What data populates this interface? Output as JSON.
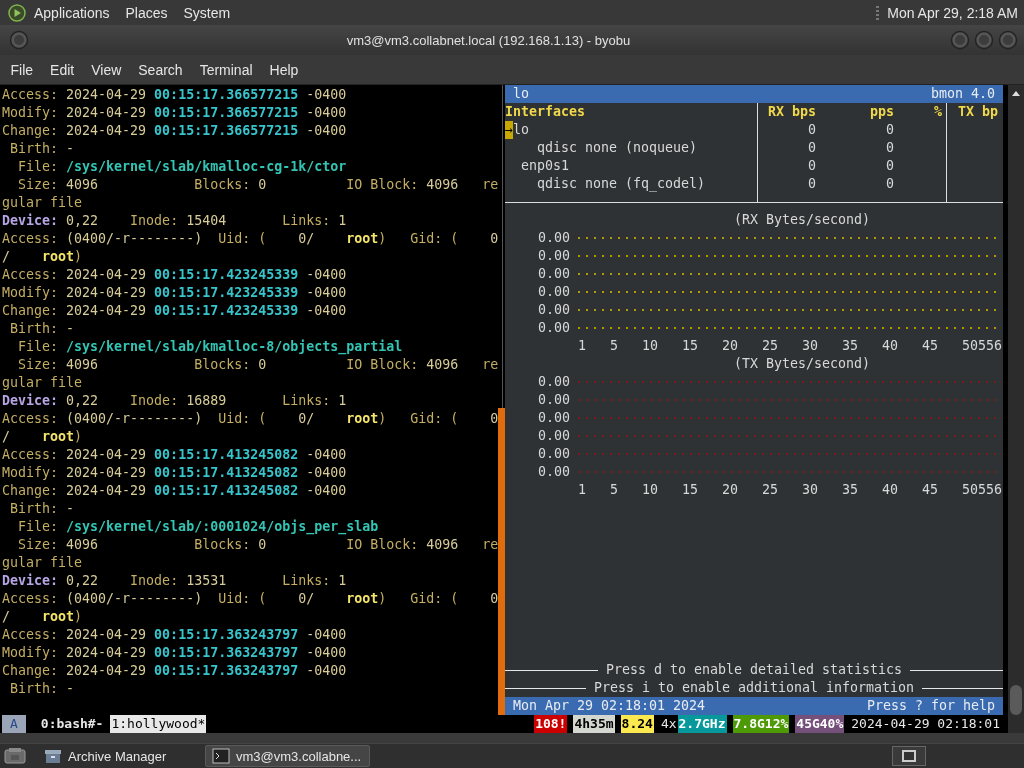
{
  "top_panel": {
    "menus": [
      "Applications",
      "Places",
      "System"
    ],
    "clock": "Mon Apr 29, 2:18 AM"
  },
  "window": {
    "title": "vm3@vm3.collabnet.local (192.168.1.13) - byobu"
  },
  "menu_bar": [
    "File",
    "Edit",
    "View",
    "Search",
    "Terminal",
    "Help"
  ],
  "terminal_lines": [
    {
      "segments": [
        {
          "kind": "label",
          "text": "Access: "
        },
        {
          "kind": "number",
          "text": "2024-04-29 "
        },
        {
          "kind": "time",
          "text": "00:15:17.366577215"
        },
        {
          "kind": "number",
          "text": " -0400"
        }
      ]
    },
    {
      "segments": [
        {
          "kind": "label",
          "text": "Modify: "
        },
        {
          "kind": "number",
          "text": "2024-04-29 "
        },
        {
          "kind": "time",
          "text": "00:15:17.366577215"
        },
        {
          "kind": "number",
          "text": " -0400"
        }
      ]
    },
    {
      "segments": [
        {
          "kind": "label",
          "text": "Change: "
        },
        {
          "kind": "number",
          "text": "2024-04-29 "
        },
        {
          "kind": "time",
          "text": "00:15:17.366577215"
        },
        {
          "kind": "number",
          "text": " -0400"
        }
      ]
    },
    {
      "segments": [
        {
          "kind": "label",
          "text": " Birth: "
        },
        {
          "kind": "number",
          "text": "-"
        }
      ]
    },
    {
      "segments": [
        {
          "kind": "label",
          "text": "  File: "
        },
        {
          "kind": "path",
          "text": "/sys/kernel/slab/kmalloc-cg-1k/ctor"
        }
      ]
    },
    {
      "segments": [
        {
          "kind": "label",
          "text": "  Size: "
        },
        {
          "kind": "number",
          "text": "4096"
        },
        {
          "kind": "label",
          "text": "            Blocks: "
        },
        {
          "kind": "number",
          "text": "0"
        },
        {
          "kind": "label",
          "text": "          IO Block: "
        },
        {
          "kind": "number",
          "text": "4096"
        },
        {
          "kind": "label",
          "text": "   re"
        }
      ]
    },
    {
      "segments": [
        {
          "kind": "label",
          "text": "gular file"
        }
      ]
    },
    {
      "segments": [
        {
          "kind": "device",
          "text": "Device: "
        },
        {
          "kind": "number",
          "text": "0,22"
        },
        {
          "kind": "label",
          "text": "    Inode: "
        },
        {
          "kind": "number",
          "text": "15404"
        },
        {
          "kind": "label",
          "text": "       Links: "
        },
        {
          "kind": "number",
          "text": "1"
        }
      ]
    },
    {
      "segments": [
        {
          "kind": "label",
          "text": "Access: "
        },
        {
          "kind": "number",
          "text": "(0400/-r--------)"
        },
        {
          "kind": "label",
          "text": "  Uid: ("
        },
        {
          "kind": "number",
          "text": "    0/    "
        },
        {
          "kind": "user",
          "text": "root"
        },
        {
          "kind": "label",
          "text": ")   Gid: ("
        },
        {
          "kind": "number",
          "text": "    0"
        }
      ]
    },
    {
      "segments": [
        {
          "kind": "number",
          "text": "/    "
        },
        {
          "kind": "user",
          "text": "root"
        },
        {
          "kind": "label",
          "text": ")"
        }
      ]
    },
    {
      "segments": [
        {
          "kind": "label",
          "text": "Access: "
        },
        {
          "kind": "number",
          "text": "2024-04-29 "
        },
        {
          "kind": "time",
          "text": "00:15:17.423245339"
        },
        {
          "kind": "number",
          "text": " -0400"
        }
      ]
    },
    {
      "segments": [
        {
          "kind": "label",
          "text": "Modify: "
        },
        {
          "kind": "number",
          "text": "2024-04-29 "
        },
        {
          "kind": "time",
          "text": "00:15:17.423245339"
        },
        {
          "kind": "number",
          "text": " -0400"
        }
      ]
    },
    {
      "segments": [
        {
          "kind": "label",
          "text": "Change: "
        },
        {
          "kind": "number",
          "text": "2024-04-29 "
        },
        {
          "kind": "time",
          "text": "00:15:17.423245339"
        },
        {
          "kind": "number",
          "text": " -0400"
        }
      ]
    },
    {
      "segments": [
        {
          "kind": "label",
          "text": " Birth: "
        },
        {
          "kind": "number",
          "text": "-"
        }
      ]
    },
    {
      "segments": [
        {
          "kind": "label",
          "text": "  File: "
        },
        {
          "kind": "path",
          "text": "/sys/kernel/slab/kmalloc-8/objects_partial"
        }
      ]
    },
    {
      "segments": [
        {
          "kind": "label",
          "text": "  Size: "
        },
        {
          "kind": "number",
          "text": "4096"
        },
        {
          "kind": "label",
          "text": "            Blocks: "
        },
        {
          "kind": "number",
          "text": "0"
        },
        {
          "kind": "label",
          "text": "          IO Block: "
        },
        {
          "kind": "number",
          "text": "4096"
        },
        {
          "kind": "label",
          "text": "   re"
        }
      ]
    },
    {
      "segments": [
        {
          "kind": "label",
          "text": "gular file"
        }
      ]
    },
    {
      "segments": [
        {
          "kind": "device",
          "text": "Device: "
        },
        {
          "kind": "number",
          "text": "0,22"
        },
        {
          "kind": "label",
          "text": "    Inode: "
        },
        {
          "kind": "number",
          "text": "16889"
        },
        {
          "kind": "label",
          "text": "       Links: "
        },
        {
          "kind": "number",
          "text": "1"
        }
      ]
    },
    {
      "segments": [
        {
          "kind": "label",
          "text": "Access: "
        },
        {
          "kind": "number",
          "text": "(0400/-r--------)"
        },
        {
          "kind": "label",
          "text": "  Uid: ("
        },
        {
          "kind": "number",
          "text": "    0/    "
        },
        {
          "kind": "user",
          "text": "root"
        },
        {
          "kind": "label",
          "text": ")   Gid: ("
        },
        {
          "kind": "number",
          "text": "    0"
        }
      ]
    },
    {
      "segments": [
        {
          "kind": "number",
          "text": "/    "
        },
        {
          "kind": "user",
          "text": "root"
        },
        {
          "kind": "label",
          "text": ")"
        }
      ]
    },
    {
      "segments": [
        {
          "kind": "label",
          "text": "Access: "
        },
        {
          "kind": "number",
          "text": "2024-04-29 "
        },
        {
          "kind": "time",
          "text": "00:15:17.413245082"
        },
        {
          "kind": "number",
          "text": " -0400"
        }
      ]
    },
    {
      "segments": [
        {
          "kind": "label",
          "text": "Modify: "
        },
        {
          "kind": "number",
          "text": "2024-04-29 "
        },
        {
          "kind": "time",
          "text": "00:15:17.413245082"
        },
        {
          "kind": "number",
          "text": " -0400"
        }
      ]
    },
    {
      "segments": [
        {
          "kind": "label",
          "text": "Change: "
        },
        {
          "kind": "number",
          "text": "2024-04-29 "
        },
        {
          "kind": "time",
          "text": "00:15:17.413245082"
        },
        {
          "kind": "number",
          "text": " -0400"
        }
      ]
    },
    {
      "segments": [
        {
          "kind": "label",
          "text": " Birth: "
        },
        {
          "kind": "number",
          "text": "-"
        }
      ]
    },
    {
      "segments": [
        {
          "kind": "label",
          "text": "  File: "
        },
        {
          "kind": "path",
          "text": "/sys/kernel/slab/:0001024/objs_per_slab"
        }
      ]
    },
    {
      "segments": [
        {
          "kind": "label",
          "text": "  Size: "
        },
        {
          "kind": "number",
          "text": "4096"
        },
        {
          "kind": "label",
          "text": "            Blocks: "
        },
        {
          "kind": "number",
          "text": "0"
        },
        {
          "kind": "label",
          "text": "          IO Block: "
        },
        {
          "kind": "number",
          "text": "4096"
        },
        {
          "kind": "label",
          "text": "   re"
        }
      ]
    },
    {
      "segments": [
        {
          "kind": "label",
          "text": "gular file"
        }
      ]
    },
    {
      "segments": [
        {
          "kind": "device",
          "text": "Device: "
        },
        {
          "kind": "number",
          "text": "0,22"
        },
        {
          "kind": "label",
          "text": "    Inode: "
        },
        {
          "kind": "number",
          "text": "13531"
        },
        {
          "kind": "label",
          "text": "       Links: "
        },
        {
          "kind": "number",
          "text": "1"
        }
      ]
    },
    {
      "segments": [
        {
          "kind": "label",
          "text": "Access: "
        },
        {
          "kind": "number",
          "text": "(0400/-r--------)"
        },
        {
          "kind": "label",
          "text": "  Uid: ("
        },
        {
          "kind": "number",
          "text": "    0/    "
        },
        {
          "kind": "user",
          "text": "root"
        },
        {
          "kind": "label",
          "text": ")   Gid: ("
        },
        {
          "kind": "number",
          "text": "    0"
        }
      ]
    },
    {
      "segments": [
        {
          "kind": "number",
          "text": "/    "
        },
        {
          "kind": "user",
          "text": "root"
        },
        {
          "kind": "label",
          "text": ")"
        }
      ]
    },
    {
      "segments": [
        {
          "kind": "label",
          "text": "Access: "
        },
        {
          "kind": "number",
          "text": "2024-04-29 "
        },
        {
          "kind": "time",
          "text": "00:15:17.363243797"
        },
        {
          "kind": "number",
          "text": " -0400"
        }
      ]
    },
    {
      "segments": [
        {
          "kind": "label",
          "text": "Modify: "
        },
        {
          "kind": "number",
          "text": "2024-04-29 "
        },
        {
          "kind": "time",
          "text": "00:15:17.363243797"
        },
        {
          "kind": "number",
          "text": " -0400"
        }
      ]
    },
    {
      "segments": [
        {
          "kind": "label",
          "text": "Change: "
        },
        {
          "kind": "number",
          "text": "2024-04-29 "
        },
        {
          "kind": "time",
          "text": "00:15:17.363243797"
        },
        {
          "kind": "number",
          "text": " -0400"
        }
      ]
    },
    {
      "segments": [
        {
          "kind": "label",
          "text": " Birth: "
        },
        {
          "kind": "number",
          "text": "-"
        }
      ]
    }
  ],
  "bmon": {
    "header_left": "lo",
    "header_right": "bmon 4.0",
    "columns": [
      "Interfaces",
      "RX bps",
      "pps",
      "%",
      "TX bp"
    ],
    "selection_marker": "→",
    "interfaces": [
      {
        "name": "lo",
        "rx_bps": "0",
        "pps": "0",
        "selected": true,
        "children": [
          {
            "name": "qdisc none (noqueue)",
            "rx_bps": "0",
            "pps": "0",
            "selected": false
          }
        ]
      },
      {
        "name": "enp0s1",
        "rx_bps": "0",
        "pps": "0",
        "selected": false,
        "children": [
          {
            "name": "qdisc none (fq_codel)",
            "rx_bps": "0",
            "pps": "0",
            "selected": false
          }
        ]
      }
    ],
    "graphs": [
      {
        "kind": "rx",
        "title": "(RX Bytes/second)",
        "y_labels": [
          "0.00",
          "0.00",
          "0.00",
          "0.00",
          "0.00",
          "0.00"
        ],
        "x_labels": [
          "1",
          "5",
          "10",
          "15",
          "20",
          "25",
          "30",
          "35",
          "40",
          "45",
          "50556"
        ]
      },
      {
        "kind": "tx",
        "title": "(TX Bytes/second)",
        "y_labels": [
          "0.00",
          "0.00",
          "0.00",
          "0.00",
          "0.00",
          "0.00"
        ],
        "x_labels": [
          "1",
          "5",
          "10",
          "15",
          "20",
          "25",
          "30",
          "35",
          "40",
          "45",
          "50556"
        ]
      }
    ],
    "hints": [
      "Press d to enable detailed statistics",
      "Press i to enable additional information"
    ],
    "status_left": "Mon Apr 29 02:18:01 2024",
    "status_right": "Press ? for help"
  },
  "byobu": {
    "session": "A",
    "windows": [
      {
        "label": "0:bash#-",
        "selected": false
      },
      {
        "label": "1:hollywood*",
        "selected": true
      }
    ],
    "indicators": [
      {
        "kind": "badge",
        "text": "108!",
        "color": "#cc0000"
      },
      {
        "kind": "badge",
        "text": "4h35m",
        "color": "#d3d7cf"
      },
      {
        "kind": "badge",
        "text": "8.24",
        "color": "#fce94f"
      },
      {
        "kind": "plain",
        "text": "4x"
      },
      {
        "kind": "badge",
        "text": "2.7GHz",
        "color": "#06989a"
      },
      {
        "kind": "badge",
        "text": "7.8G12%",
        "color": "#4e9a06"
      },
      {
        "kind": "badge",
        "text": "45G40%",
        "color": "#75507b"
      },
      {
        "kind": "plain",
        "text": "2024-04-29 02:18:01"
      }
    ]
  },
  "taskbar": {
    "tasks": [
      {
        "kind": "archive",
        "label": "Archive Manager",
        "selected": false
      },
      {
        "kind": "terminal",
        "label": "vm3@vm3.collabne...",
        "selected": true
      }
    ]
  }
}
